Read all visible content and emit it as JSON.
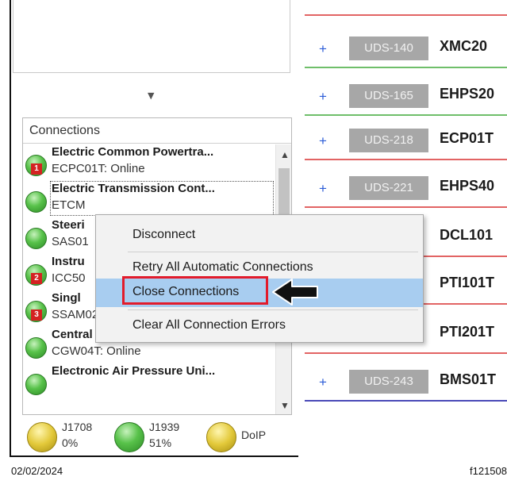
{
  "connections": {
    "header": "Connections",
    "items": [
      {
        "title": "Electric Common Powertra...",
        "status": "ECPC01T: Online",
        "badge": "1"
      },
      {
        "title": "Electric Transmission Cont...",
        "status": "ETCM",
        "badge": ""
      },
      {
        "title": "Steeri",
        "status": "SAS01",
        "badge": ""
      },
      {
        "title": "Instru",
        "status": "ICC50",
        "badge": "2"
      },
      {
        "title": "Singl",
        "status": "SSAM02T: Online",
        "badge": "3"
      },
      {
        "title": "Central Gateway",
        "status": "CGW04T: Online",
        "badge": ""
      },
      {
        "title": "Electronic Air Pressure Uni...",
        "status": "",
        "badge": ""
      }
    ]
  },
  "buses": [
    {
      "name": "J1708",
      "percent": "0%",
      "color": "yellow"
    },
    {
      "name": "J1939",
      "percent": "51%",
      "color": "green"
    },
    {
      "name": "DoIP",
      "percent": "",
      "color": "yellow"
    }
  ],
  "modules": [
    {
      "tag": "UDS-140",
      "name": "XMC20",
      "line_color": "#6fbf6a"
    },
    {
      "tag": "UDS-165",
      "name": "EHPS20",
      "line_color": "#6fbf6a"
    },
    {
      "tag": "UDS-218",
      "name": "ECP01T",
      "line_color": "#e26464"
    },
    {
      "tag": "UDS-221",
      "name": "EHPS40",
      "line_color": "#e26464"
    },
    {
      "tag": "",
      "name": "DCL101",
      "line_color": "#e26464"
    },
    {
      "tag": "",
      "name": "PTI101T",
      "line_color": "#e26464"
    },
    {
      "tag": "",
      "name": "PTI201T",
      "line_color": "#e26464"
    },
    {
      "tag": "UDS-243",
      "name": "BMS01T",
      "line_color": "#4a4ab8"
    }
  ],
  "context_menu": {
    "items": [
      "Disconnect",
      "Retry All Automatic Connections",
      "Close Connections",
      "Clear All Connection Errors"
    ],
    "highlighted": "Close Connections"
  },
  "icons": {
    "scroll_up": "▲",
    "scroll_down": "▼",
    "splitter": "▼",
    "plus": "+"
  },
  "footer": {
    "date": "02/02/2024",
    "code": "f121508"
  }
}
